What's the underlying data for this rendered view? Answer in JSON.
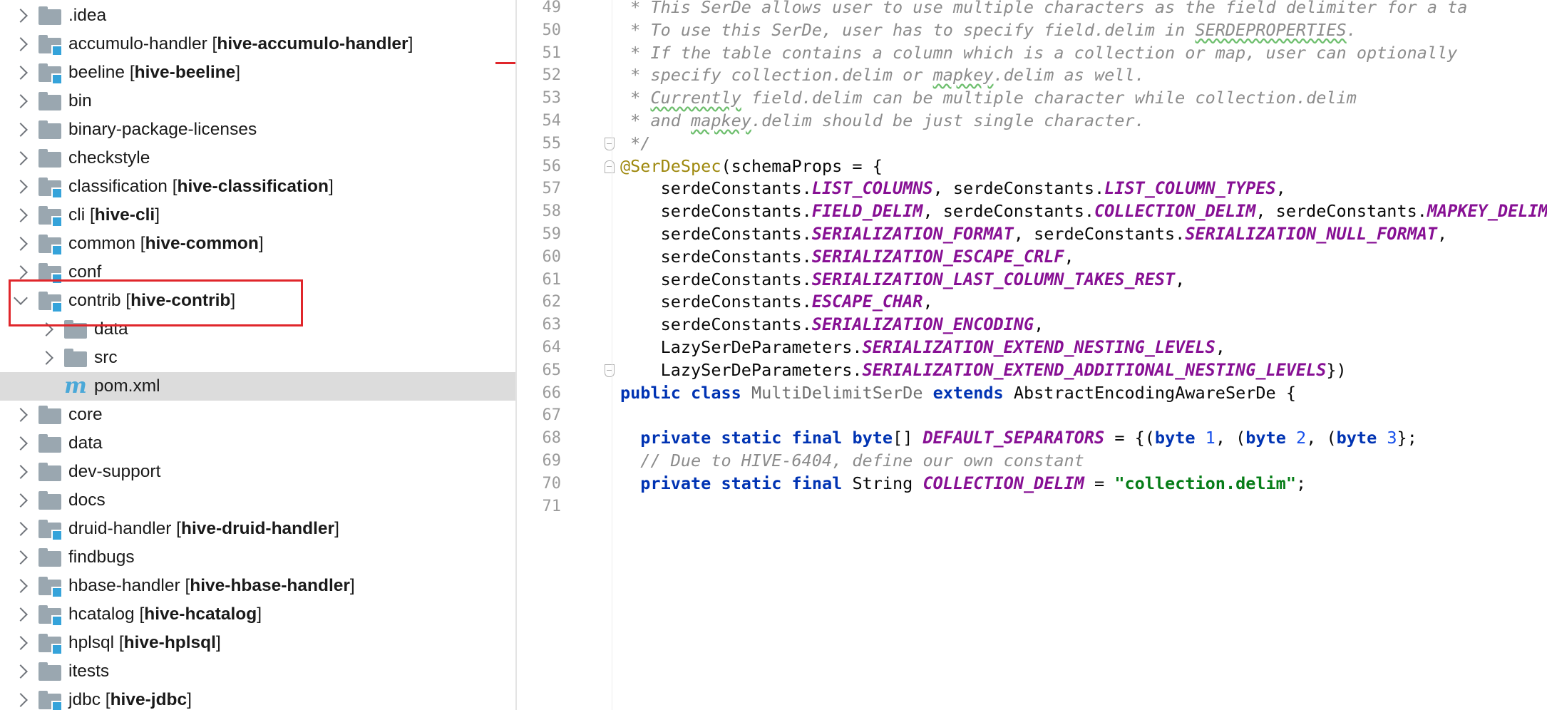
{
  "tree": {
    "items": [
      {
        "id": "idea",
        "depth": 0,
        "expand": "collapsed",
        "icon": "folder-icon",
        "label": ".idea",
        "module": ""
      },
      {
        "id": "accumulo-handler",
        "depth": 0,
        "expand": "collapsed",
        "icon": "module-folder-icon",
        "label": "accumulo-handler",
        "module": "hive-accumulo-handler"
      },
      {
        "id": "beeline",
        "depth": 0,
        "expand": "collapsed",
        "icon": "module-folder-icon",
        "label": "beeline",
        "module": "hive-beeline"
      },
      {
        "id": "bin",
        "depth": 0,
        "expand": "collapsed",
        "icon": "folder-icon",
        "label": "bin",
        "module": ""
      },
      {
        "id": "binary-package-licenses",
        "depth": 0,
        "expand": "collapsed",
        "icon": "folder-icon",
        "label": "binary-package-licenses",
        "module": ""
      },
      {
        "id": "checkstyle",
        "depth": 0,
        "expand": "collapsed",
        "icon": "folder-icon",
        "label": "checkstyle",
        "module": ""
      },
      {
        "id": "classification",
        "depth": 0,
        "expand": "collapsed",
        "icon": "module-folder-icon",
        "label": "classification",
        "module": "hive-classification"
      },
      {
        "id": "cli",
        "depth": 0,
        "expand": "collapsed",
        "icon": "module-folder-icon",
        "label": "cli",
        "module": "hive-cli"
      },
      {
        "id": "common",
        "depth": 0,
        "expand": "collapsed",
        "icon": "module-folder-icon",
        "label": "common",
        "module": "hive-common"
      },
      {
        "id": "conf",
        "depth": 0,
        "expand": "collapsed",
        "icon": "module-folder-icon",
        "label": "conf",
        "module": ""
      },
      {
        "id": "contrib",
        "depth": 0,
        "expand": "expanded",
        "icon": "module-folder-icon",
        "label": "contrib",
        "module": "hive-contrib"
      },
      {
        "id": "contrib-data",
        "depth": 1,
        "expand": "collapsed",
        "icon": "folder-icon",
        "label": "data",
        "module": ""
      },
      {
        "id": "contrib-src",
        "depth": 1,
        "expand": "collapsed",
        "icon": "folder-icon",
        "label": "src",
        "module": ""
      },
      {
        "id": "contrib-pom",
        "depth": 1,
        "expand": "none",
        "icon": "maven-icon",
        "label": "pom.xml",
        "module": "",
        "selected": true
      },
      {
        "id": "core",
        "depth": 0,
        "expand": "collapsed",
        "icon": "folder-icon",
        "label": "core",
        "module": ""
      },
      {
        "id": "data",
        "depth": 0,
        "expand": "collapsed",
        "icon": "folder-icon",
        "label": "data",
        "module": ""
      },
      {
        "id": "dev-support",
        "depth": 0,
        "expand": "collapsed",
        "icon": "folder-icon",
        "label": "dev-support",
        "module": ""
      },
      {
        "id": "docs",
        "depth": 0,
        "expand": "collapsed",
        "icon": "folder-icon",
        "label": "docs",
        "module": ""
      },
      {
        "id": "druid-handler",
        "depth": 0,
        "expand": "collapsed",
        "icon": "module-folder-icon",
        "label": "druid-handler",
        "module": "hive-druid-handler"
      },
      {
        "id": "findbugs",
        "depth": 0,
        "expand": "collapsed",
        "icon": "folder-icon",
        "label": "findbugs",
        "module": ""
      },
      {
        "id": "hbase-handler",
        "depth": 0,
        "expand": "collapsed",
        "icon": "module-folder-icon",
        "label": "hbase-handler",
        "module": "hive-hbase-handler"
      },
      {
        "id": "hcatalog",
        "depth": 0,
        "expand": "collapsed",
        "icon": "module-folder-icon",
        "label": "hcatalog",
        "module": "hive-hcatalog"
      },
      {
        "id": "hplsql",
        "depth": 0,
        "expand": "collapsed",
        "icon": "module-folder-icon",
        "label": "hplsql",
        "module": "hive-hplsql"
      },
      {
        "id": "itests",
        "depth": 0,
        "expand": "collapsed",
        "icon": "folder-icon",
        "label": "itests",
        "module": ""
      },
      {
        "id": "jdbc",
        "depth": 0,
        "expand": "collapsed",
        "icon": "module-folder-icon",
        "label": "jdbc",
        "module": "hive-jdbc"
      }
    ]
  },
  "editor": {
    "lines": [
      {
        "n": "49",
        "fold": "",
        "indent": 0,
        "tokens": [
          [
            "cm",
            " * This SerDe allows user to use multiple characters as the field delimiter for a ta"
          ]
        ]
      },
      {
        "n": "50",
        "fold": "",
        "indent": 0,
        "tokens": [
          [
            "cm",
            " * To use this SerDe, user has to specify field.delim in "
          ],
          [
            "cm u",
            "SERDEPROPERTIES"
          ],
          [
            "cm",
            "."
          ]
        ]
      },
      {
        "n": "51",
        "fold": "",
        "indent": 0,
        "tokens": [
          [
            "cm",
            " * If the table contains a column which is a collection or map, user can optionally"
          ]
        ]
      },
      {
        "n": "52",
        "fold": "",
        "indent": 0,
        "tokens": [
          [
            "cm",
            " * specify collection.delim or "
          ],
          [
            "cm u",
            "mapkey"
          ],
          [
            "cm",
            ".delim as well."
          ]
        ]
      },
      {
        "n": "53",
        "fold": "",
        "indent": 0,
        "tokens": [
          [
            "cm",
            " * "
          ],
          [
            "cm u",
            "Currently"
          ],
          [
            "cm",
            " field.delim can be multiple character while collection.delim"
          ]
        ]
      },
      {
        "n": "54",
        "fold": "",
        "indent": 0,
        "tokens": [
          [
            "cm",
            " * and "
          ],
          [
            "cm u",
            "mapkey"
          ],
          [
            "cm",
            ".delim should be just single character."
          ]
        ]
      },
      {
        "n": "55",
        "fold": "bot",
        "indent": 0,
        "tokens": [
          [
            "cm",
            " */"
          ]
        ]
      },
      {
        "n": "56",
        "fold": "top",
        "indent": 0,
        "tokens": [
          [
            "an",
            "@SerDeSpec"
          ],
          [
            "",
            "(schemaProps = {"
          ]
        ]
      },
      {
        "n": "57",
        "fold": "",
        "indent": 0,
        "tokens": [
          [
            "",
            "    serdeConstants."
          ],
          [
            "cst",
            "LIST_COLUMNS"
          ],
          [
            "",
            ", serdeConstants."
          ],
          [
            "cst",
            "LIST_COLUMN_TYPES"
          ],
          [
            "",
            ","
          ]
        ]
      },
      {
        "n": "58",
        "fold": "",
        "indent": 0,
        "tokens": [
          [
            "",
            "    serdeConstants."
          ],
          [
            "cst",
            "FIELD_DELIM"
          ],
          [
            "",
            ", serdeConstants."
          ],
          [
            "cst",
            "COLLECTION_DELIM"
          ],
          [
            "",
            ", serdeConstants."
          ],
          [
            "cst",
            "MAPKEY_DELIM"
          ],
          [
            "",
            ","
          ]
        ]
      },
      {
        "n": "59",
        "fold": "",
        "indent": 0,
        "tokens": [
          [
            "",
            "    serdeConstants."
          ],
          [
            "cst",
            "SERIALIZATION_FORMAT"
          ],
          [
            "",
            ", serdeConstants."
          ],
          [
            "cst",
            "SERIALIZATION_NULL_FORMAT"
          ],
          [
            "",
            ","
          ]
        ]
      },
      {
        "n": "60",
        "fold": "",
        "indent": 0,
        "tokens": [
          [
            "",
            "    serdeConstants."
          ],
          [
            "cst",
            "SERIALIZATION_ESCAPE_CRLF"
          ],
          [
            "",
            ","
          ]
        ]
      },
      {
        "n": "61",
        "fold": "",
        "indent": 0,
        "tokens": [
          [
            "",
            "    serdeConstants."
          ],
          [
            "cst",
            "SERIALIZATION_LAST_COLUMN_TAKES_REST"
          ],
          [
            "",
            ","
          ]
        ]
      },
      {
        "n": "62",
        "fold": "",
        "indent": 0,
        "tokens": [
          [
            "",
            "    serdeConstants."
          ],
          [
            "cst",
            "ESCAPE_CHAR"
          ],
          [
            "",
            ","
          ]
        ]
      },
      {
        "n": "63",
        "fold": "",
        "indent": 0,
        "tokens": [
          [
            "",
            "    serdeConstants."
          ],
          [
            "cst",
            "SERIALIZATION_ENCODING"
          ],
          [
            "",
            ","
          ]
        ]
      },
      {
        "n": "64",
        "fold": "",
        "indent": 0,
        "tokens": [
          [
            "",
            "    LazySerDeParameters."
          ],
          [
            "cst",
            "SERIALIZATION_EXTEND_NESTING_LEVELS"
          ],
          [
            "",
            ","
          ]
        ]
      },
      {
        "n": "65",
        "fold": "bot",
        "indent": 0,
        "tokens": [
          [
            "",
            "    LazySerDeParameters."
          ],
          [
            "cst",
            "SERIALIZATION_EXTEND_ADDITIONAL_NESTING_LEVELS"
          ],
          [
            "",
            "})"
          ]
        ]
      },
      {
        "n": "66",
        "fold": "",
        "indent": 0,
        "tokens": [
          [
            "kw",
            "public"
          ],
          [
            "",
            " "
          ],
          [
            "kw",
            "class"
          ],
          [
            "",
            " "
          ],
          [
            "gray",
            "MultiDelimitSerDe"
          ],
          [
            "",
            " "
          ],
          [
            "kw",
            "extends"
          ],
          [
            "",
            " AbstractEncodingAwareSerDe {"
          ]
        ]
      },
      {
        "n": "67",
        "fold": "",
        "indent": 0,
        "tokens": [
          [
            "",
            ""
          ]
        ]
      },
      {
        "n": "68",
        "fold": "",
        "indent": 0,
        "tokens": [
          [
            "",
            "  "
          ],
          [
            "kw",
            "private"
          ],
          [
            "",
            " "
          ],
          [
            "kw",
            "static"
          ],
          [
            "",
            " "
          ],
          [
            "kw",
            "final"
          ],
          [
            "",
            " "
          ],
          [
            "kw",
            "byte"
          ],
          [
            "",
            "[] "
          ],
          [
            "cst",
            "DEFAULT_SEPARATORS"
          ],
          [
            "",
            " = {("
          ],
          [
            "kw",
            "byte"
          ],
          [
            "",
            " "
          ],
          [
            "num",
            "1"
          ],
          [
            "",
            ", ("
          ],
          [
            "kw",
            "byte"
          ],
          [
            "",
            " "
          ],
          [
            "num",
            "2"
          ],
          [
            "",
            ", ("
          ],
          [
            "kw",
            "byte"
          ],
          [
            "",
            " "
          ],
          [
            "num",
            "3"
          ],
          [
            "",
            "};"
          ]
        ]
      },
      {
        "n": "69",
        "fold": "",
        "indent": 0,
        "tokens": [
          [
            "",
            "  "
          ],
          [
            "cm",
            "// Due to HIVE-6404, define our own constant"
          ]
        ]
      },
      {
        "n": "70",
        "fold": "",
        "indent": 0,
        "tokens": [
          [
            "",
            "  "
          ],
          [
            "kw",
            "private"
          ],
          [
            "",
            " "
          ],
          [
            "kw",
            "static"
          ],
          [
            "",
            " "
          ],
          [
            "kw",
            "final"
          ],
          [
            "",
            " String "
          ],
          [
            "cst",
            "COLLECTION_DELIM"
          ],
          [
            "",
            " = "
          ],
          [
            "str",
            "\"collection.delim\""
          ],
          [
            "",
            ";"
          ]
        ]
      },
      {
        "n": "71",
        "fold": "",
        "indent": 0,
        "tokens": [
          [
            "",
            ""
          ]
        ]
      }
    ]
  }
}
